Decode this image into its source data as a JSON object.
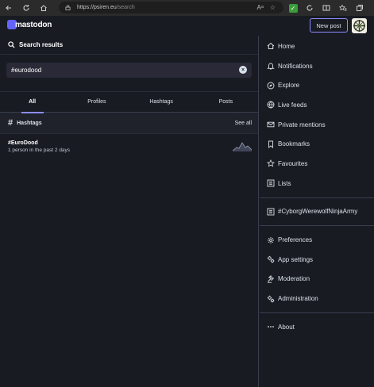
{
  "browser": {
    "url_host": "https://psiren.eu",
    "url_path": "/search",
    "reader_label": "Aᵃ"
  },
  "header": {
    "logo_text": "mastodon",
    "new_post_label": "New post"
  },
  "search": {
    "title": "Search results",
    "query": "#eurodood",
    "tabs": [
      "All",
      "Profiles",
      "Hashtags",
      "Posts"
    ],
    "active_tab": "All",
    "section_label": "Hashtags",
    "see_all_label": "See all",
    "results": [
      {
        "name": "#EuroDood",
        "meta": "1 person in the past 2 days"
      }
    ]
  },
  "nav": {
    "items": [
      {
        "label": "Home",
        "icon": "home-icon"
      },
      {
        "label": "Notifications",
        "icon": "bell-icon"
      },
      {
        "label": "Explore",
        "icon": "compass-icon"
      },
      {
        "label": "Live feeds",
        "icon": "globe-icon"
      },
      {
        "label": "Private mentions",
        "icon": "envelope-icon"
      },
      {
        "label": "Bookmarks",
        "icon": "bookmark-icon"
      },
      {
        "label": "Favourites",
        "icon": "star-icon"
      },
      {
        "label": "Lists",
        "icon": "list-icon"
      }
    ],
    "list_items": [
      {
        "label": "#CyborgWerewolfNinjaArmy",
        "icon": "list-icon"
      }
    ],
    "settings_items": [
      {
        "label": "Preferences",
        "icon": "gear-icon"
      },
      {
        "label": "App settings",
        "icon": "gears-icon"
      },
      {
        "label": "Moderation",
        "icon": "gavel-icon"
      },
      {
        "label": "Administration",
        "icon": "gears-icon"
      }
    ],
    "about_item": {
      "label": "About",
      "icon": "ellipsis-icon"
    }
  },
  "colors": {
    "background": "#191b22",
    "accent": "#8c8dff",
    "text": "#d9e1e8"
  }
}
